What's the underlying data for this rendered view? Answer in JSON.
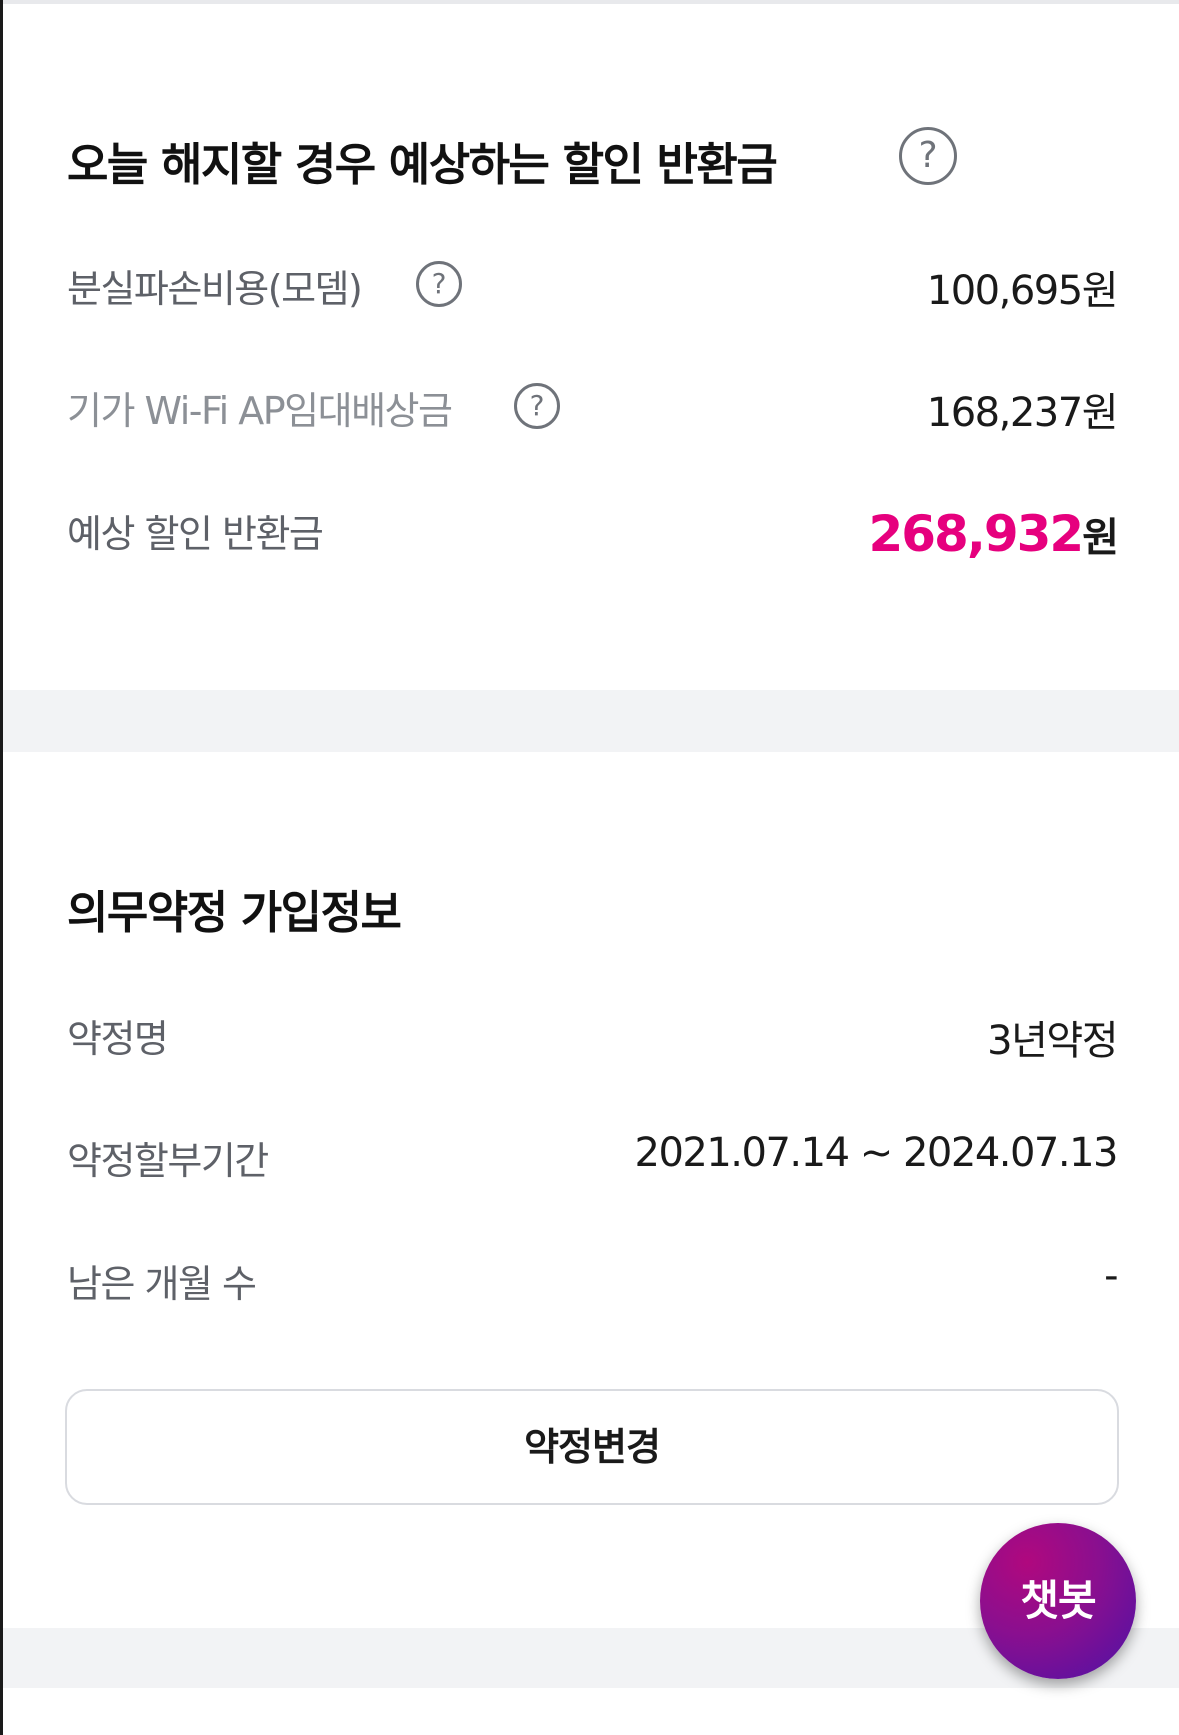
{
  "termination": {
    "title": "오늘 해지할 경우 예상하는 할인 반환금",
    "help_symbol": "?",
    "rows": [
      {
        "label": "분실파손비용(모뎀)",
        "value": "100,695원"
      },
      {
        "label": "기가 Wi-Fi AP임대배상금",
        "value": "168,237원"
      }
    ],
    "total": {
      "label": "예상 할인 반환금",
      "amount": "268,932",
      "unit": "원"
    }
  },
  "contract": {
    "title": "의무약정 가입정보",
    "rows": [
      {
        "label": "약정명",
        "value": "3년약정"
      },
      {
        "label": "약정할부기간",
        "value": "2021.07.14 ~ 2024.07.13"
      },
      {
        "label": "남은 개월 수",
        "value": "-"
      }
    ],
    "change_button": "약정변경"
  },
  "chatbot": {
    "label": "챗봇"
  },
  "colors": {
    "accent": "#e6007e",
    "chatbot_start": "#b0087e",
    "chatbot_end": "#4d12a6",
    "section_gap": "#f2f3f5"
  }
}
